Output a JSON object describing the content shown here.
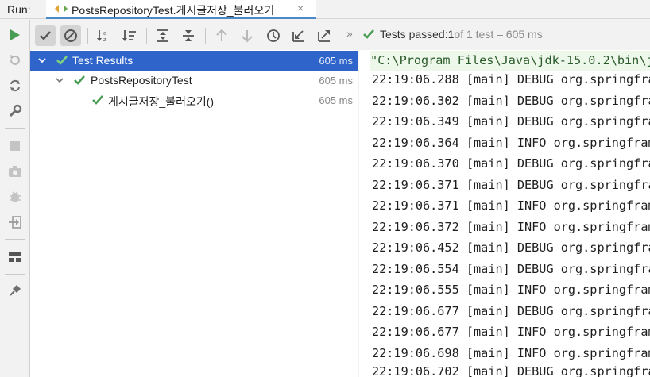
{
  "run_label": "Run:",
  "tab": {
    "title": "PostsRepositoryTest.게시글저장_불러오기",
    "close": "×"
  },
  "toolbar": {
    "more": "»"
  },
  "status": {
    "prefix": "Tests passed: ",
    "passed": "1",
    "of_text": " of 1 test – 605 ms"
  },
  "tree": [
    {
      "label": "Test Results",
      "duration": "605 ms"
    },
    {
      "label": "PostsRepositoryTest",
      "duration": "605 ms"
    },
    {
      "label": "게시글저장_불러오기()",
      "duration": "605 ms"
    }
  ],
  "console": {
    "command": "\"C:\\Program Files\\Java\\jdk-15.0.2\\bin\\j",
    "lines": [
      "22:19:06.288 [main] DEBUG org.springfra",
      "22:19:06.302 [main] DEBUG org.springfra",
      "22:19:06.349 [main] DEBUG org.springfra",
      "22:19:06.364 [main] INFO org.springfram",
      "22:19:06.370 [main] DEBUG org.springfra",
      "22:19:06.371 [main] DEBUG org.springfra",
      "22:19:06.371 [main] INFO org.springfram",
      "22:19:06.372 [main] INFO org.springfram",
      "22:19:06.452 [main] DEBUG org.springfra",
      "22:19:06.554 [main] DEBUG org.springfra",
      "22:19:06.555 [main] INFO org.springfram",
      "22:19:06.677 [main] DEBUG org.springfra",
      "22:19:06.677 [main] INFO org.springfram",
      "22:19:06.698 [main] INFO org.springfram",
      "22:19:06.702 [main] DEBUG org.springfra"
    ]
  },
  "colors": {
    "pass_green": "#499c54",
    "selection": "#2f65ca",
    "tab_underline": "#4a88c7"
  }
}
